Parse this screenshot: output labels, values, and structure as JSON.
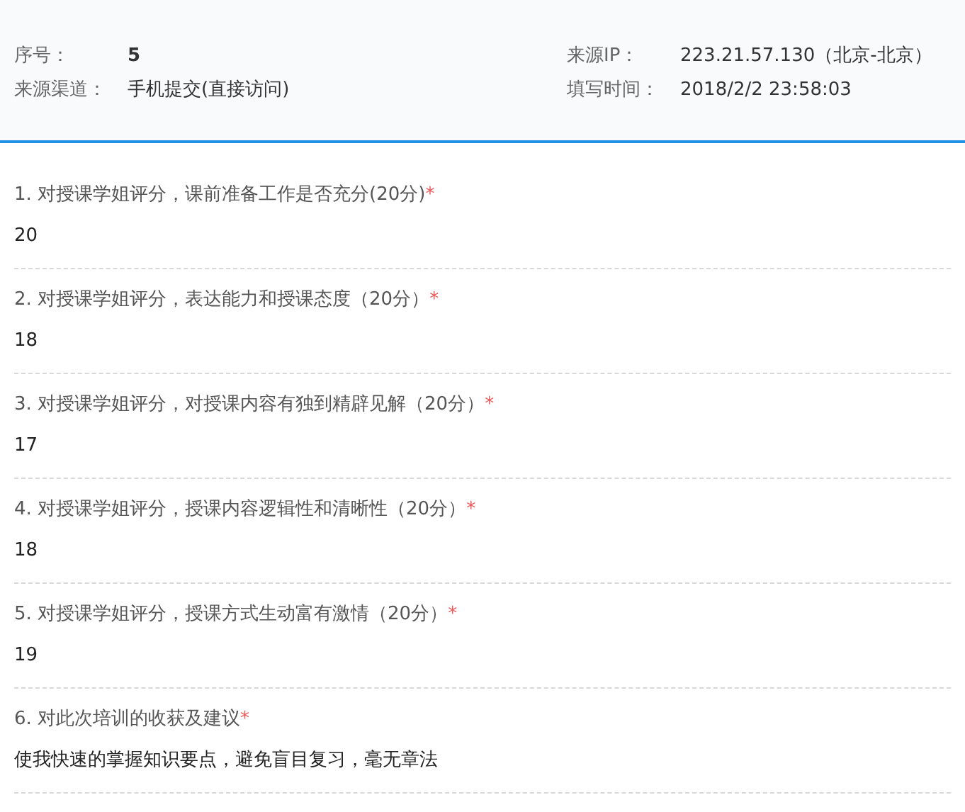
{
  "meta": {
    "left": [
      {
        "label": "序号：",
        "value": "5",
        "bold": true
      },
      {
        "label": "来源渠道：",
        "value": "手机提交(直接访问)",
        "bold": false
      }
    ],
    "right": [
      {
        "label": "来源IP：",
        "value": "223.21.57.130（北京-北京）",
        "bold": false
      },
      {
        "label": "填写时间：",
        "value": "2018/2/2 23:58:03",
        "bold": false
      }
    ]
  },
  "questions": [
    {
      "question": "1. 对授课学姐评分，课前准备工作是否充分(20分)",
      "mark": "*",
      "answer": "20"
    },
    {
      "question": "2. 对授课学姐评分，表达能力和授课态度（20分）",
      "mark": "*",
      "answer": "18"
    },
    {
      "question": "3. 对授课学姐评分，对授课内容有独到精辟见解（20分）",
      "mark": "*",
      "answer": "17"
    },
    {
      "question": "4. 对授课学姐评分，授课内容逻辑性和清晰性（20分）",
      "mark": "*",
      "answer": "18"
    },
    {
      "question": "5. 对授课学姐评分，授课方式生动富有激情（20分）",
      "mark": "*",
      "answer": "19"
    },
    {
      "question": "6. 对此次培训的收获及建议",
      "mark": "*",
      "answer": "使我快速的掌握知识要点，避免盲目复习，毫无章法"
    }
  ]
}
